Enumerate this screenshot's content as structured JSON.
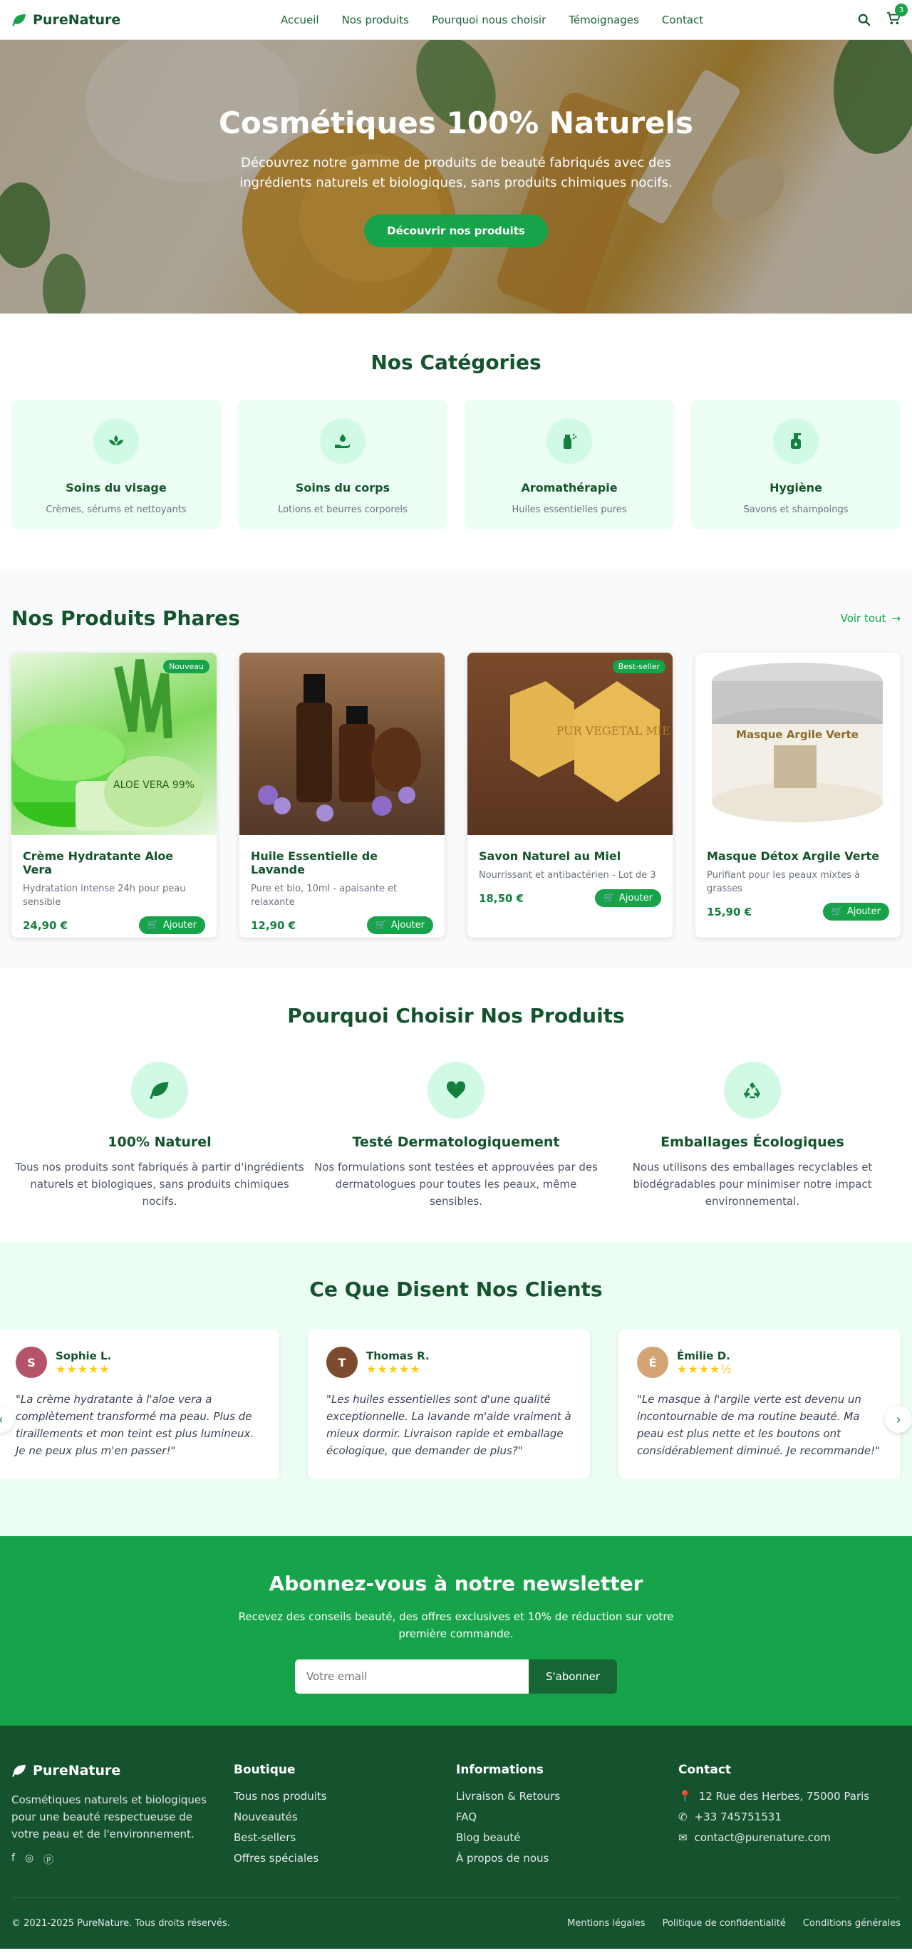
{
  "nav": {
    "brand": "PureNature",
    "links": [
      "Accueil",
      "Nos produits",
      "Pourquoi nous choisir",
      "Témoignages",
      "Contact"
    ],
    "cart_count": "3"
  },
  "hero": {
    "title": "Cosmétiques 100% Naturels",
    "subtitle": "Découvrez notre gamme de produits de beauté fabriqués avec des ingrédients naturels et biologiques, sans produits chimiques nocifs.",
    "cta": "Découvrir nos produits"
  },
  "categories": {
    "title": "Nos Catégories",
    "items": [
      {
        "name": "Soins du visage",
        "desc": "Crèmes, sérums et nettoyants",
        "icon": "spa-icon"
      },
      {
        "name": "Soins du corps",
        "desc": "Lotions et beurres corporels",
        "icon": "hand-holding-drop-icon"
      },
      {
        "name": "Aromathérapie",
        "desc": "Huiles essentielles pures",
        "icon": "spray-bottle-icon"
      },
      {
        "name": "Hygiène",
        "desc": "Savons et shampoings",
        "icon": "pump-soap-icon"
      }
    ]
  },
  "products": {
    "title": "Nos Produits Phares",
    "see_all": "Voir tout",
    "add_label": "Ajouter",
    "items": [
      {
        "name": "Crème Hydratante Aloe Vera",
        "desc": "Hydratation intense 24h pour peau sensible",
        "price": "24,90 €",
        "tag": "Nouveau",
        "image": "aloe-vera-gel-jar",
        "img_label": "ALOE VERA 99%"
      },
      {
        "name": "Huile Essentielle de Lavande",
        "desc": "Pure et bio, 10ml - apaisante et relaxante",
        "price": "12,90 €",
        "tag": "",
        "image": "lavender-oil-bottles"
      },
      {
        "name": "Savon Naturel au Miel",
        "desc": "Nourrissant et antibactérien - Lot de 3",
        "price": "18,50 €",
        "tag": "Best-seller",
        "image": "honey-soap-bars",
        "img_label": "PUR VEGETAL MIEL"
      },
      {
        "name": "Masque Détox Argile Verte",
        "desc": "Purifiant pour les peaux mixtes à grasses",
        "price": "15,90 €",
        "tag": "",
        "image": "clay-mask-jar",
        "img_label": "Masque Argile Verte"
      }
    ]
  },
  "why": {
    "title": "Pourquoi Choisir Nos Produits",
    "items": [
      {
        "name": "100% Naturel",
        "desc": "Tous nos produits sont fabriqués à partir d'ingrédients naturels et biologiques, sans produits chimiques nocifs.",
        "icon": "leaf-icon"
      },
      {
        "name": "Testé Dermatologiquement",
        "desc": "Nos formulations sont testées et approuvées par des dermatologues pour toutes les peaux, même sensibles.",
        "icon": "heart-icon"
      },
      {
        "name": "Emballages Écologiques",
        "desc": "Nous utilisons des emballages recyclables et biodégradables pour minimiser notre impact environnemental.",
        "icon": "recycle-icon"
      }
    ]
  },
  "testimonials": {
    "title": "Ce Que Disent Nos Clients",
    "items": [
      {
        "name": "Sophie L.",
        "stars": "★★★★★",
        "rating": 5,
        "text": "\"La crème hydratante à l'aloe vera a complètement transformé ma peau. Plus de tiraillements et mon teint est plus lumineux. Je ne peux plus m'en passer!\"",
        "avatar_color": "#b45369"
      },
      {
        "name": "Thomas R.",
        "stars": "★★★★★",
        "rating": 5,
        "text": "\"Les huiles essentielles sont d'une qualité exceptionnelle. La lavande m'aide vraiment à mieux dormir. Livraison rapide et emballage écologique, que demander de plus?\"",
        "avatar_color": "#7c4a2d"
      },
      {
        "name": "Émilie D.",
        "stars": "★★★★½",
        "rating": 4.5,
        "text": "\"Le masque à l'argile verte est devenu un incontournable de ma routine beauté. Ma peau est plus nette et les boutons ont considérablement diminué. Je recommande!\"",
        "avatar_color": "#d4a373"
      }
    ]
  },
  "newsletter": {
    "title": "Abonnez-vous à notre newsletter",
    "subtitle": "Recevez des conseils beauté, des offres exclusives et 10% de réduction sur votre première commande.",
    "placeholder": "Votre email",
    "button": "S'abonner"
  },
  "footer": {
    "brand": "PureNature",
    "about": "Cosmétiques naturels et biologiques pour une beauté respectueuse de votre peau et de l'environnement.",
    "social": [
      "facebook-icon",
      "instagram-icon",
      "pinterest-icon"
    ],
    "boutique_title": "Boutique",
    "boutique": [
      "Tous nos produits",
      "Nouveautés",
      "Best-sellers",
      "Offres spéciales"
    ],
    "info_title": "Informations",
    "info": [
      "Livraison & Retours",
      "FAQ",
      "Blog beauté",
      "À propos de nous"
    ],
    "contact_title": "Contact",
    "address": "12 Rue des Herbes, 75000 Paris",
    "phone": "+33 745751531",
    "email": "contact@purenature.com",
    "copyright": "© 2021-2025 PureNature. Tous droits réservés.",
    "legal": [
      "Mentions légales",
      "Politique de confidentialité",
      "Conditions générales"
    ]
  },
  "colors": {
    "primary": "#16a34a",
    "dark": "#14532d",
    "light_bg": "#ecfdf3"
  }
}
